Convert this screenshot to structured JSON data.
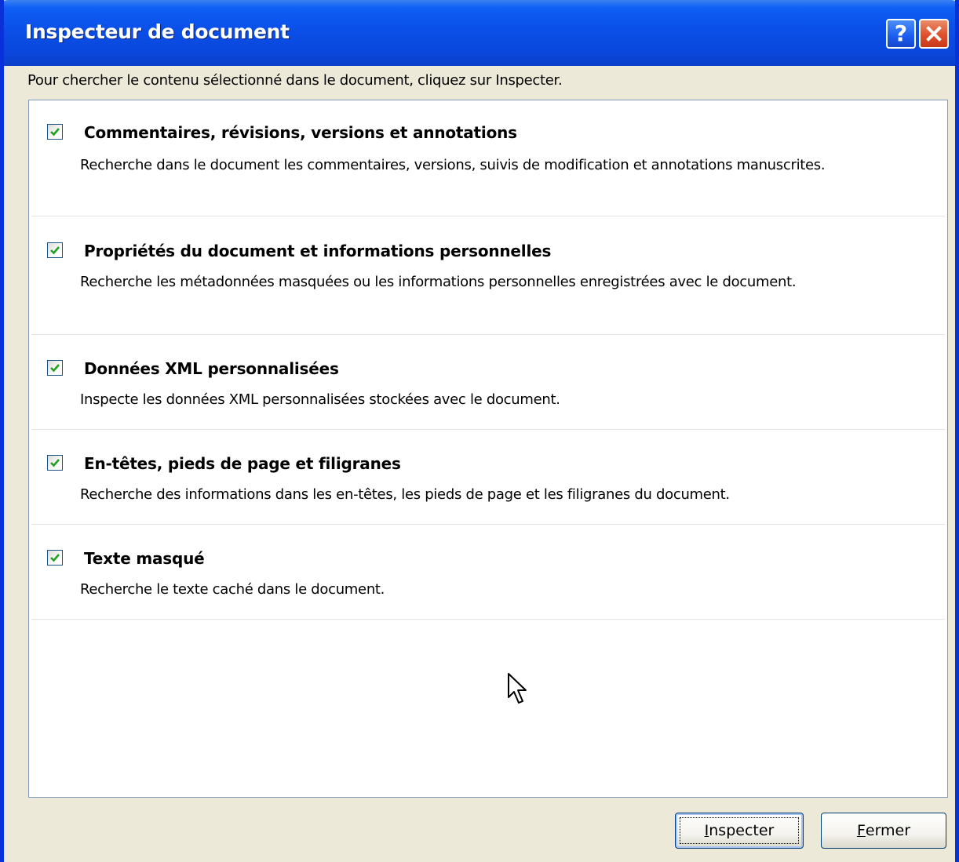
{
  "window": {
    "title": "Inspecteur de document",
    "help_button": "?",
    "close_icon": "close-icon"
  },
  "instruction": "Pour chercher le contenu sélectionné dans le document, cliquez sur Inspecter.",
  "items": [
    {
      "title": "Commentaires, révisions, versions et annotations",
      "description": "Recherche dans le document les commentaires, versions, suivis de modification et annotations manuscrites.",
      "checked": true
    },
    {
      "title": "Propriétés du document et informations personnelles",
      "description": "Recherche les métadonnées masquées ou les informations personnelles enregistrées avec le document.",
      "checked": true
    },
    {
      "title": "Données XML personnalisées",
      "description": "Inspecte les données XML personnalisées stockées avec le document.",
      "checked": true
    },
    {
      "title": "En-têtes, pieds de page et filigranes",
      "description": "Recherche des informations dans les en-têtes, les pieds de page et les filigranes du document.",
      "checked": true
    },
    {
      "title": "Texte masqué",
      "description": "Recherche le texte caché dans le document.",
      "checked": true
    }
  ],
  "buttons": {
    "inspect": {
      "mnemonic": "I",
      "rest": "nspecter"
    },
    "close": {
      "mnemonic": "F",
      "rest": "ermer"
    }
  },
  "colors": {
    "titlebar": "#0a4fe8",
    "frame": "#0831d9",
    "dialog_bg": "#ece9d8",
    "checkmark": "#21a121"
  }
}
